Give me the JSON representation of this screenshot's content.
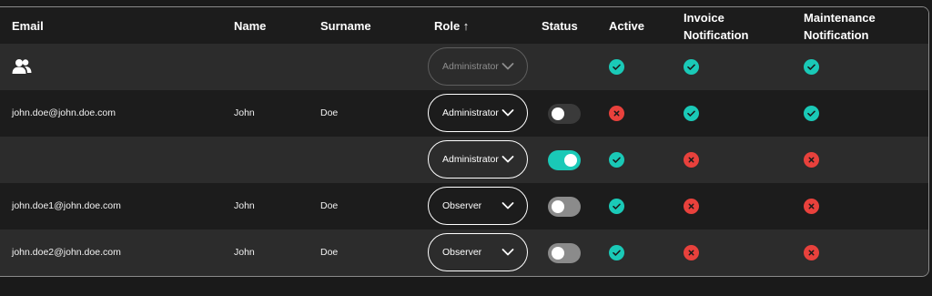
{
  "colors": {
    "check": "#1ac9b7",
    "cross": "#e8413c",
    "toggle_on": "#1ac9b7"
  },
  "headers": {
    "email": "Email",
    "name": "Name",
    "surname": "Surname",
    "role": "Role ↑",
    "status": "Status",
    "active": "Active",
    "invoice_line1": "Invoice",
    "invoice_line2": "Notification",
    "maintenance_line1": "Maintenance",
    "maintenance_line2": "Notification"
  },
  "rows": [
    {
      "icon": "users-icon",
      "email": "",
      "name": "",
      "surname": "",
      "role": "Administrator",
      "role_disabled": true,
      "status": null,
      "active": "check",
      "invoice": "check",
      "maintenance": "check"
    },
    {
      "email": "john.doe@john.doe.com",
      "name": "John",
      "surname": "Doe",
      "role": "Administrator",
      "status": "off",
      "active": "cross",
      "invoice": "check",
      "maintenance": "check"
    },
    {
      "email": "",
      "name": "",
      "surname": "",
      "role": "Administrator",
      "status": "on",
      "active": "check",
      "invoice": "cross",
      "maintenance": "cross"
    },
    {
      "email": "john.doe1@john.doe.com",
      "name": "John",
      "surname": "Doe",
      "role": "Observer",
      "status": "off",
      "active": "check",
      "invoice": "cross",
      "maintenance": "cross"
    },
    {
      "email": "john.doe2@john.doe.com",
      "name": "John",
      "surname": "Doe",
      "role": "Observer",
      "status": "off",
      "active": "check",
      "invoice": "cross",
      "maintenance": "cross"
    }
  ]
}
